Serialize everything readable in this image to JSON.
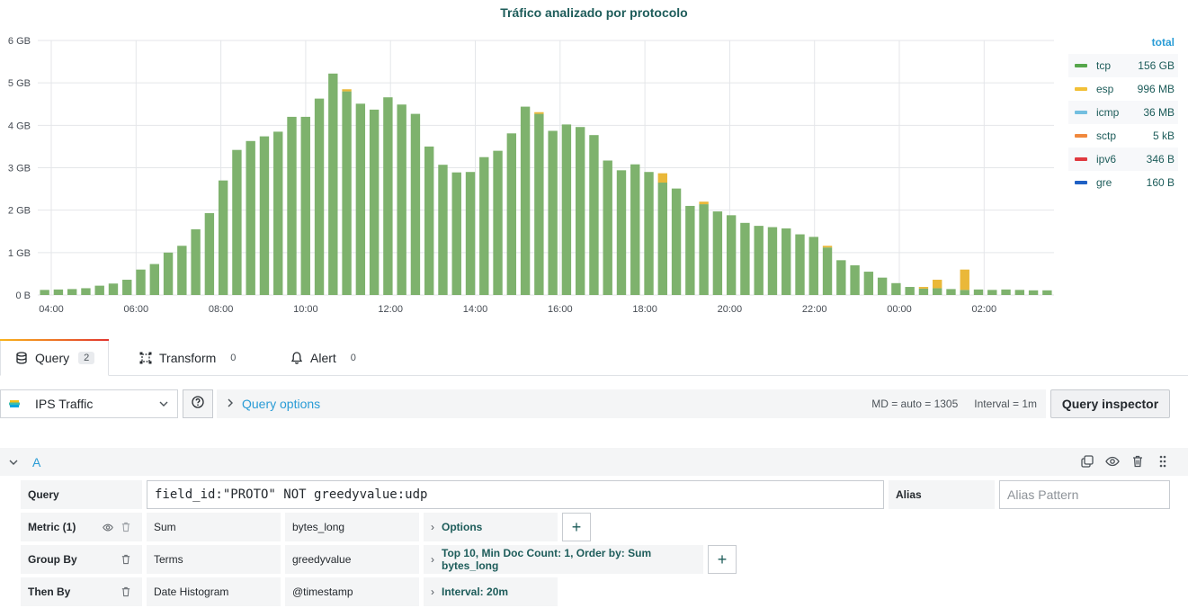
{
  "chart": {
    "title": "Tráfico analizado por protocolo"
  },
  "chart_data": {
    "type": "bar",
    "stacked": true,
    "title": "Tráfico analizado por protocolo",
    "y_ticks": [
      "0 B",
      "1 GB",
      "2 GB",
      "3 GB",
      "4 GB",
      "5 GB",
      "6 GB"
    ],
    "ylim": [
      0,
      6
    ],
    "x_ticks": [
      "04:00",
      "06:00",
      "08:00",
      "10:00",
      "12:00",
      "14:00",
      "16:00",
      "18:00",
      "20:00",
      "22:00",
      "00:00",
      "02:00"
    ],
    "grid": true,
    "legend_position": "right",
    "series": [
      {
        "name": "tcp",
        "color": "#7eb26d",
        "values": [
          0.12,
          0.13,
          0.14,
          0.16,
          0.22,
          0.27,
          0.36,
          0.6,
          0.73,
          1.0,
          1.16,
          1.55,
          1.93,
          2.7,
          3.42,
          3.63,
          3.74,
          3.85,
          4.2,
          4.2,
          4.63,
          5.22,
          4.8,
          4.51,
          4.37,
          4.66,
          4.49,
          4.27,
          3.5,
          3.07,
          2.89,
          2.9,
          3.25,
          3.4,
          3.81,
          4.44,
          4.27,
          3.87,
          4.02,
          3.96,
          3.77,
          3.17,
          2.94,
          3.08,
          2.9,
          2.65,
          2.51,
          2.1,
          2.14,
          1.97,
          1.88,
          1.7,
          1.63,
          1.6,
          1.57,
          1.43,
          1.37,
          1.12,
          0.82,
          0.7,
          0.55,
          0.41,
          0.28,
          0.19,
          0.15,
          0.16,
          0.14,
          0.12,
          0.13,
          0.12,
          0.13,
          0.12,
          0.11,
          0.11
        ]
      },
      {
        "name": "esp",
        "color": "#eab839",
        "values": [
          0,
          0,
          0,
          0,
          0,
          0,
          0,
          0,
          0,
          0,
          0,
          0,
          0,
          0,
          0,
          0,
          0,
          0,
          0,
          0,
          0,
          0,
          0.05,
          0,
          0,
          0,
          0,
          0,
          0,
          0,
          0,
          0,
          0,
          0,
          0,
          0,
          0.04,
          0,
          0,
          0,
          0,
          0,
          0,
          0,
          0,
          0.22,
          0,
          0,
          0.06,
          0,
          0,
          0,
          0,
          0,
          0,
          0,
          0,
          0.04,
          0,
          0,
          0,
          0,
          0,
          0,
          0.04,
          0.2,
          0,
          0.48,
          0,
          0,
          0,
          0,
          0,
          0
        ]
      },
      {
        "name": "icmp",
        "color": "#6ed0e0",
        "values": []
      },
      {
        "name": "sctp",
        "color": "#ef843c",
        "values": []
      },
      {
        "name": "ipv6",
        "color": "#e24d42",
        "values": []
      },
      {
        "name": "gre",
        "color": "#1f78c1",
        "values": []
      }
    ]
  },
  "legend": {
    "header": "total",
    "items": [
      {
        "name": "tcp",
        "total": "156 GB",
        "color": "#56a64b"
      },
      {
        "name": "esp",
        "total": "996 MB",
        "color": "#f2c037"
      },
      {
        "name": "icmp",
        "total": "36 MB",
        "color": "#73bfe0"
      },
      {
        "name": "sctp",
        "total": "5 kB",
        "color": "#f0883d"
      },
      {
        "name": "ipv6",
        "total": "346 B",
        "color": "#e0393f"
      },
      {
        "name": "gre",
        "total": "160 B",
        "color": "#1f60c4"
      }
    ]
  },
  "tabs": [
    {
      "label": "Query",
      "count": "2"
    },
    {
      "label": "Transform",
      "count": "0"
    },
    {
      "label": "Alert",
      "count": "0"
    }
  ],
  "toolbar": {
    "datasource": "IPS Traffic",
    "query_options": "Query options",
    "md": "MD = auto = 1305",
    "interval": "Interval = 1m",
    "inspector": "Query inspector"
  },
  "query": {
    "ref": "A",
    "query_label": "Query",
    "query_value": "field_id:\"PROTO\" NOT greedyvalue:udp",
    "alias_label": "Alias",
    "alias_placeholder": "Alias Pattern",
    "metric_label": "Metric (1)",
    "metric_type": "Sum",
    "metric_field": "bytes_long",
    "metric_options": "Options",
    "groupby_label": "Group By",
    "groupby_type": "Terms",
    "groupby_field": "greedyvalue",
    "groupby_options": "Top 10, Min Doc Count: 1, Order by: Sum bytes_long",
    "thenby_label": "Then By",
    "thenby_type": "Date Histogram",
    "thenby_field": "@timestamp",
    "thenby_options": "Interval: 20m"
  }
}
